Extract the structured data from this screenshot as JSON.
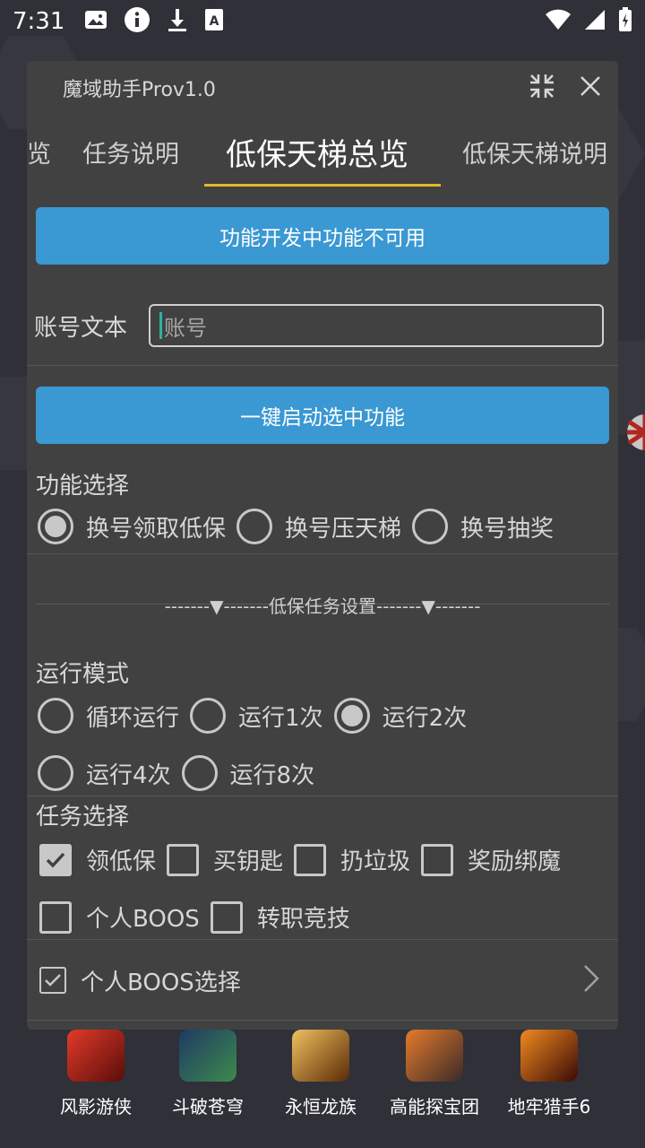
{
  "status_bar": {
    "time": "7:31",
    "icons_left": [
      "image-icon",
      "info-icon",
      "download-icon",
      "text-icon"
    ],
    "icons_right": [
      "wifi-icon",
      "signal-icon",
      "battery-icon"
    ]
  },
  "window": {
    "title": "魔域助手Prov1.0",
    "tabs": [
      {
        "label": "览"
      },
      {
        "label": "任务说明"
      },
      {
        "label": "低保天梯总览",
        "active": true
      },
      {
        "label": "低保天梯说明"
      }
    ],
    "notice_button": "功能开发中功能不可用",
    "account": {
      "label": "账号文本",
      "placeholder": "账号"
    },
    "start_button": "一键启动选中功能",
    "function_select": {
      "label": "功能选择",
      "options": [
        {
          "label": "换号领取低保",
          "selected": true
        },
        {
          "label": "换号压天梯",
          "selected": false
        },
        {
          "label": "换号抽奖",
          "selected": false
        }
      ]
    },
    "section_title": "-------▼-------低保任务设置-------▼-------",
    "run_mode": {
      "label": "运行模式",
      "options": [
        {
          "label": "循环运行",
          "selected": false
        },
        {
          "label": "运行1次",
          "selected": false
        },
        {
          "label": "运行2次",
          "selected": true
        },
        {
          "label": "运行4次",
          "selected": false
        },
        {
          "label": "运行8次",
          "selected": false
        }
      ]
    },
    "task_select": {
      "label": "任务选择",
      "options": [
        {
          "label": "领低保",
          "checked": true
        },
        {
          "label": "买钥匙",
          "checked": false
        },
        {
          "label": "扔垃圾",
          "checked": false
        },
        {
          "label": "奖励绑魔",
          "checked": false
        },
        {
          "label": "个人BOOS",
          "checked": false
        },
        {
          "label": "转职竞技",
          "checked": false
        }
      ]
    },
    "boos_select": {
      "label": "个人BOOS选择",
      "checked": true
    }
  },
  "dock": [
    {
      "label": "风影游侠",
      "color": "#b3261e"
    },
    {
      "label": "斗破苍穹",
      "color": "#2a6a3a"
    },
    {
      "label": "永恒龙族",
      "color": "#8a5a12"
    },
    {
      "label": "高能探宝团",
      "color": "#c2561e"
    },
    {
      "label": "地牢猎手6",
      "color": "#7a1d0c"
    }
  ]
}
